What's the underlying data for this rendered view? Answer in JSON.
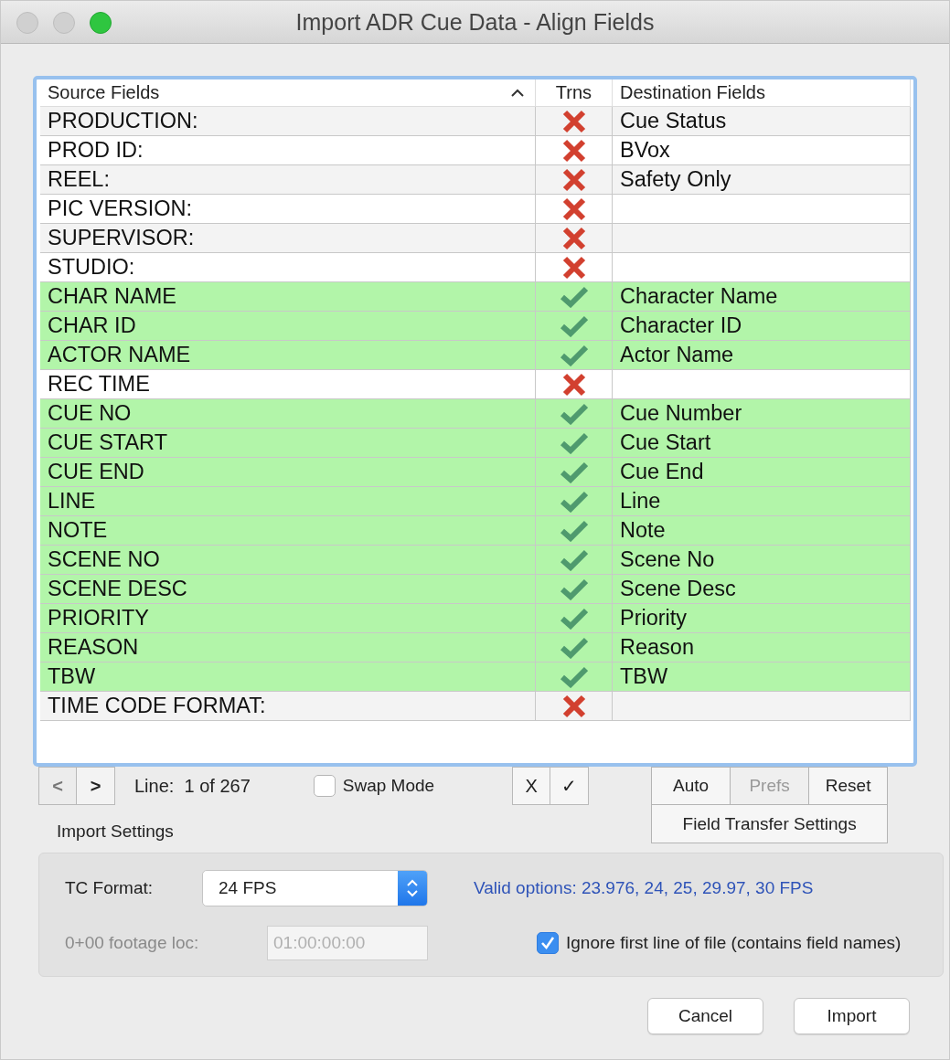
{
  "window": {
    "title": "Import ADR Cue Data - Align Fields"
  },
  "table": {
    "columns": [
      {
        "label": "Source Fields",
        "sorted": true
      },
      {
        "label": "Trns",
        "sorted": false
      },
      {
        "label": "Destination Fields",
        "sorted": false
      }
    ],
    "rows": [
      {
        "source": "PRODUCTION:",
        "transfer": false,
        "destination": "Cue Status"
      },
      {
        "source": "PROD ID:",
        "transfer": false,
        "destination": "BVox"
      },
      {
        "source": "REEL:",
        "transfer": false,
        "destination": "Safety Only"
      },
      {
        "source": "PIC VERSION:",
        "transfer": false
      },
      {
        "source": "SUPERVISOR:",
        "transfer": false
      },
      {
        "source": "STUDIO:",
        "transfer": false
      },
      {
        "source": "CHAR NAME",
        "transfer": true,
        "destination": "Character Name"
      },
      {
        "source": "CHAR ID",
        "transfer": true,
        "destination": "Character ID"
      },
      {
        "source": "ACTOR NAME",
        "transfer": true,
        "destination": "Actor Name"
      },
      {
        "source": "REC TIME",
        "transfer": false
      },
      {
        "source": "CUE NO",
        "transfer": true,
        "destination": "Cue Number"
      },
      {
        "source": "CUE START",
        "transfer": true,
        "destination": "Cue Start"
      },
      {
        "source": "CUE END",
        "transfer": true,
        "destination": "Cue End"
      },
      {
        "source": "LINE",
        "transfer": true,
        "destination": "Line"
      },
      {
        "source": "NOTE",
        "transfer": true,
        "destination": "Note"
      },
      {
        "source": "SCENE NO",
        "transfer": true,
        "destination": "Scene No"
      },
      {
        "source": "SCENE DESC",
        "transfer": true,
        "destination": "Scene Desc"
      },
      {
        "source": "PRIORITY",
        "transfer": true,
        "destination": "Priority"
      },
      {
        "source": "REASON",
        "transfer": true,
        "destination": "Reason"
      },
      {
        "source": "TBW",
        "transfer": true,
        "destination": "TBW"
      },
      {
        "source": "TIME CODE FORMAT:",
        "transfer": false
      }
    ]
  },
  "navigation": {
    "previous": "<",
    "next": ">",
    "line": "Line:  1 of 267"
  },
  "swap_mode": {
    "label": "Swap Mode",
    "checked": false
  },
  "mark_buttons": [
    "X",
    "✓"
  ],
  "actions": [
    {
      "label": "Auto",
      "disabled": false
    },
    {
      "label": "Prefs",
      "disabled": true
    },
    {
      "label": "Reset",
      "disabled": false
    }
  ],
  "field_transfer_button": "Field Transfer Settings",
  "import_settings": {
    "title": "Import Settings",
    "tc_format": {
      "label": "TC Format:",
      "value": "24 FPS"
    },
    "valid_options": "Valid options: 23.976, 24, 25, 29.97, 30 FPS",
    "footage_loc": {
      "label": "0+00 footage loc:",
      "placeholder": "01:00:00:00",
      "disabled": true
    },
    "ignore_first_line": {
      "label": "Ignore first line of file (contains field names)",
      "checked": true
    }
  },
  "buttons": [
    "Cancel",
    "Import"
  ]
}
